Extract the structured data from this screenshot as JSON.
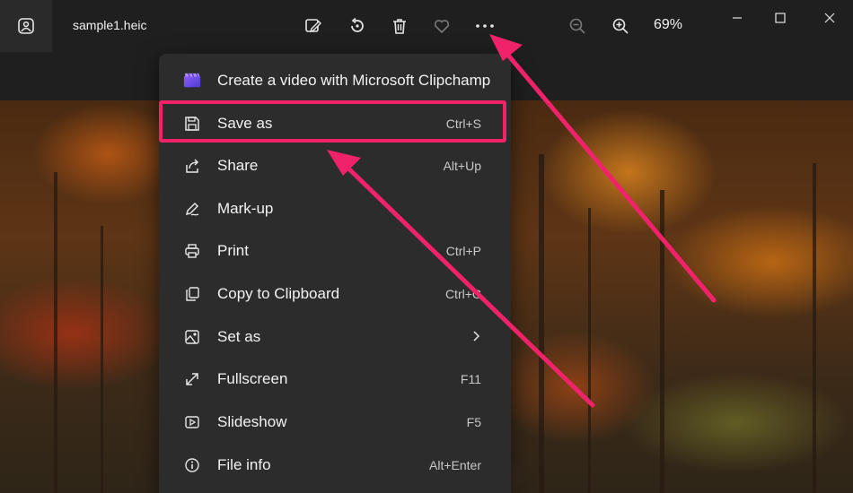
{
  "titlebar": {
    "file_name": "sample1.heic",
    "zoom_level": "69%",
    "toolbar_icons": [
      "edit-image-icon",
      "rotate-icon",
      "delete-icon",
      "favorite-heart-icon",
      "more-options-icon",
      "zoom-out-icon",
      "zoom-in-icon"
    ],
    "window_controls": [
      "minimize-icon",
      "maximize-icon",
      "close-icon"
    ]
  },
  "menu": {
    "items": [
      {
        "label": "Create a video with Microsoft Clipchamp",
        "shortcut": "",
        "icon": "clipchamp-icon"
      },
      {
        "label": "Save as",
        "shortcut": "Ctrl+S",
        "icon": "save-icon"
      },
      {
        "label": "Share",
        "shortcut": "Alt+Up",
        "icon": "share-icon"
      },
      {
        "label": "Mark-up",
        "shortcut": "",
        "icon": "markup-pen-icon"
      },
      {
        "label": "Print",
        "shortcut": "Ctrl+P",
        "icon": "printer-icon"
      },
      {
        "label": "Copy to Clipboard",
        "shortcut": "Ctrl+C",
        "icon": "copy-icon"
      },
      {
        "label": "Set as",
        "shortcut": "",
        "icon": "set-as-icon",
        "submenu_icon": "chevron-right-icon"
      },
      {
        "label": "Fullscreen",
        "shortcut": "F11",
        "icon": "fullscreen-icon"
      },
      {
        "label": "Slideshow",
        "shortcut": "F5",
        "icon": "slideshow-icon"
      },
      {
        "label": "File info",
        "shortcut": "Alt+Enter",
        "icon": "info-icon"
      }
    ]
  },
  "annotation": {
    "highlight_color": "#f0226a"
  }
}
